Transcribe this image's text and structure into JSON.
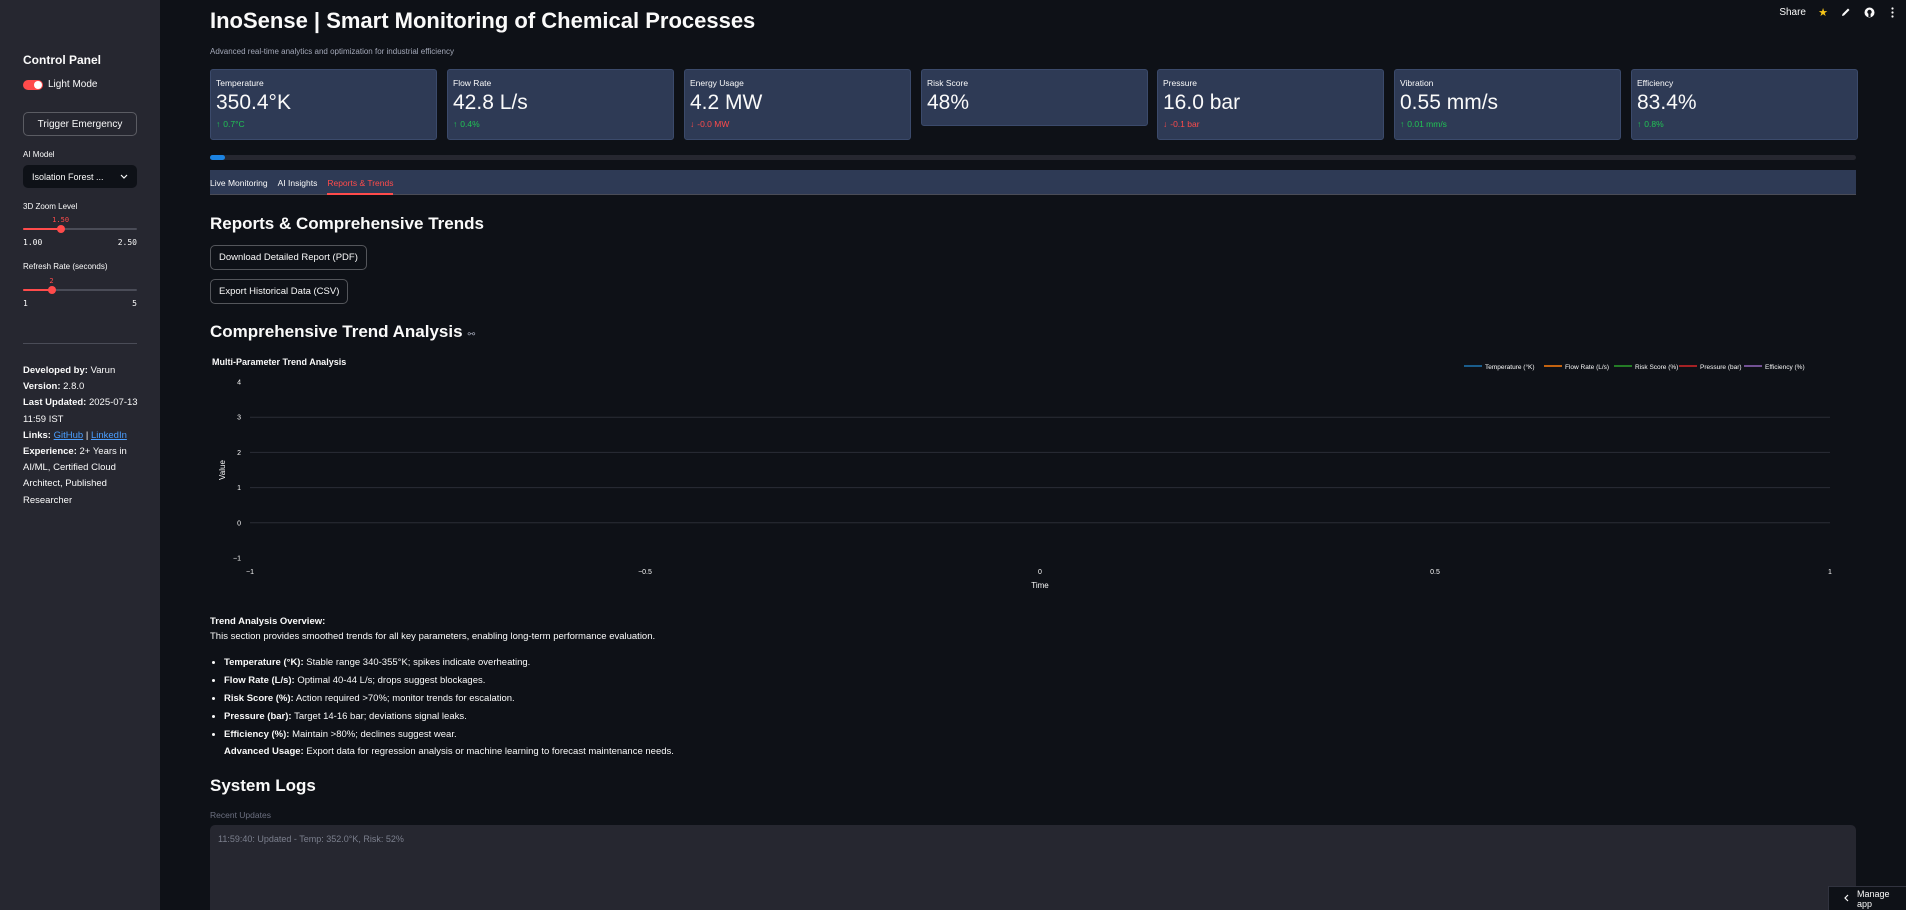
{
  "sidebar": {
    "title": "Control Panel",
    "light_mode_label": "Light Mode",
    "emergency_button": "Trigger Emergency",
    "ai_model_label": "AI Model",
    "ai_model_value": "Isolation Forest ...",
    "zoom": {
      "label": "3D Zoom Level",
      "value": "1.50",
      "min": "1.00",
      "max": "2.50",
      "fraction": 0.33
    },
    "refresh": {
      "label": "Refresh Rate (seconds)",
      "value": "2",
      "min": "1",
      "max": "5",
      "fraction": 0.25
    },
    "info": {
      "developed_label": "Developed by:",
      "developed_value": "Varun",
      "version_label": "Version:",
      "version_value": "2.8.0",
      "updated_label": "Last Updated:",
      "updated_value": "2025-07-13 11:59 IST",
      "links_label": "Links:",
      "github": "GitHub",
      "sep": "|",
      "linkedin": "LinkedIn",
      "experience_label": "Experience:",
      "experience_value": "2+ Years in AI/ML, Certified Cloud Architect, Published Researcher"
    }
  },
  "topbar": {
    "share": "Share"
  },
  "header": {
    "title": "InoSense | Smart Monitoring of Chemical Processes",
    "subtitle": "Advanced real-time analytics and optimization for industrial efficiency"
  },
  "metrics": [
    {
      "label": "Temperature",
      "value": "350.4°K",
      "delta": "0.7°C",
      "dir": "up"
    },
    {
      "label": "Flow Rate",
      "value": "42.8 L/s",
      "delta": "0.4%",
      "dir": "up"
    },
    {
      "label": "Energy Usage",
      "value": "4.2 MW",
      "delta": "-0.0 MW",
      "dir": "down"
    },
    {
      "label": "Risk Score",
      "value": "48%",
      "delta": "",
      "dir": ""
    },
    {
      "label": "Pressure",
      "value": "16.0 bar",
      "delta": "-0.1 bar",
      "dir": "down"
    },
    {
      "label": "Vibration",
      "value": "0.55 mm/s",
      "delta": "0.01 mm/s",
      "dir": "up"
    },
    {
      "label": "Efficiency",
      "value": "83.4%",
      "delta": "0.8%",
      "dir": "up"
    }
  ],
  "progress": {
    "fraction": 0.009
  },
  "tabs": [
    "Live Monitoring",
    "AI Insights",
    "Reports & Trends"
  ],
  "reports": {
    "heading": "Reports & Comprehensive Trends",
    "download_button": "Download Detailed Report (PDF)",
    "export_button": "Export Historical Data (CSV)"
  },
  "trend_heading": "Comprehensive Trend Analysis",
  "chart_data": {
    "type": "line",
    "title": "Multi-Parameter Trend Analysis",
    "xlabel": "Time",
    "ylabel": "Value",
    "xlim": [
      -1,
      1
    ],
    "ylim": [
      -1,
      4
    ],
    "x_ticks": [
      "−1",
      "−0.5",
      "0",
      "0.5",
      "1"
    ],
    "y_ticks": [
      "−1",
      "0",
      "1",
      "2",
      "3",
      "4"
    ],
    "grid": true,
    "legend_position": "top-right",
    "series": [
      {
        "name": "Temperature (°K)",
        "color": "#1f77b4",
        "values": []
      },
      {
        "name": "Flow Rate (L/s)",
        "color": "#ff7f0e",
        "values": []
      },
      {
        "name": "Risk Score (%)",
        "color": "#2ca02c",
        "values": []
      },
      {
        "name": "Pressure (bar)",
        "color": "#d62728",
        "values": []
      },
      {
        "name": "Efficiency (%)",
        "color": "#9467bd",
        "values": []
      }
    ]
  },
  "overview": {
    "title": "Trend Analysis Overview:",
    "intro": "This section provides smoothed trends for all key parameters, enabling long-term performance evaluation.",
    "items": [
      {
        "label": "Temperature (°K):",
        "text": "Stable range 340-355°K; spikes indicate overheating."
      },
      {
        "label": "Flow Rate (L/s):",
        "text": "Optimal 40-44 L/s; drops suggest blockages."
      },
      {
        "label": "Risk Score (%):",
        "text": "Action required >70%; monitor trends for escalation."
      },
      {
        "label": "Pressure (bar):",
        "text": "Target 14-16 bar; deviations signal leaks."
      },
      {
        "label": "Efficiency (%):",
        "text": "Maintain >80%; declines suggest wear."
      }
    ],
    "advanced_label": "Advanced Usage:",
    "advanced_text": "Export data for regression analysis or machine learning to forecast maintenance needs."
  },
  "logs": {
    "heading": "System Logs",
    "subtitle": "Recent Updates",
    "entry": "11:59:40: Updated - Temp: 352.0°K, Risk: 52%"
  },
  "manage_app": "Manage app"
}
